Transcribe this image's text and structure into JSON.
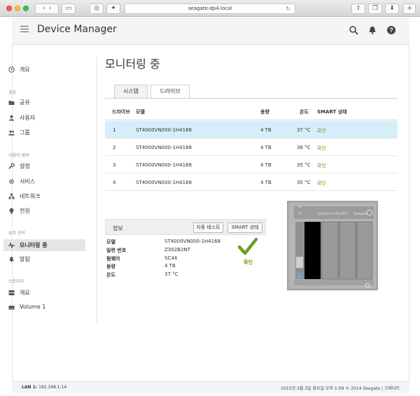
{
  "browser": {
    "url": "seagate-dp4.local"
  },
  "app": {
    "title": "Device Manager"
  },
  "sidebar": {
    "groups": [
      {
        "label": "공유"
      },
      {
        "label": "사용자 정의"
      },
      {
        "label": "유지 관리"
      },
      {
        "label": "스토리지"
      }
    ],
    "items": [
      {
        "label": "개요",
        "icon": "clock-icon"
      },
      {
        "label": "공유",
        "icon": "folder-icon"
      },
      {
        "label": "사용자",
        "icon": "user-icon"
      },
      {
        "label": "그룹",
        "icon": "group-icon"
      },
      {
        "label": "설정",
        "icon": "wrench-icon"
      },
      {
        "label": "서비스",
        "icon": "gear-icon"
      },
      {
        "label": "네트워크",
        "icon": "network-icon"
      },
      {
        "label": "전원",
        "icon": "bulb-icon"
      },
      {
        "label": "모니터링 중",
        "icon": "pulse-icon",
        "active": true
      },
      {
        "label": "알림",
        "icon": "bell-icon"
      },
      {
        "label": "개요",
        "icon": "storage-icon"
      },
      {
        "label": "Volume 1",
        "icon": "volume-icon"
      }
    ]
  },
  "main": {
    "title": "모니터링 중",
    "tabs": [
      {
        "label": "시스템",
        "active": false
      },
      {
        "label": "드라이브",
        "active": true
      }
    ],
    "table": {
      "headers": {
        "drive": "드라이브",
        "model": "모델",
        "capacity": "용량",
        "temp": "온도",
        "smart": "SMART 상태"
      },
      "rows": [
        {
          "drive": "1",
          "model": "ST4000VN000-1H4168",
          "capacity": "4 TB",
          "temp": "37 °C",
          "smart": "확인",
          "selected": true
        },
        {
          "drive": "2",
          "model": "ST4000VN000-1H4168",
          "capacity": "4 TB",
          "temp": "36 °C",
          "smart": "확인"
        },
        {
          "drive": "3",
          "model": "ST4000VN000-1H4168",
          "capacity": "4 TB",
          "temp": "35 °C",
          "smart": "확인"
        },
        {
          "drive": "4",
          "model": "ST4000VN000-1H4168",
          "capacity": "4 TB",
          "temp": "35 °C",
          "smart": "확인"
        }
      ]
    },
    "info": {
      "title": "정보",
      "selftest_label": "자동 테스트",
      "smartstat_label": "SMART 상태",
      "fields": [
        {
          "key": "모델",
          "value": "ST4000VN000-1H4168"
        },
        {
          "key": "일련 번호",
          "value": "Z302B2NT"
        },
        {
          "key": "펌웨어",
          "value": "SC44"
        },
        {
          "key": "용량",
          "value": "4 TB"
        },
        {
          "key": "온도",
          "value": "37 °C"
        }
      ],
      "status": "확인"
    },
    "device_image": {
      "brand": "Seagate",
      "model_label": "SEAGATE-NAS-PRO"
    }
  },
  "footer": {
    "lan_label": "LAN 1:",
    "lan_ip": "192.168.1.14",
    "right": "2015년 2월 3일 화요일  오후 1:09  © 2014 Seagate | 크레디트"
  },
  "colors": {
    "selected_row": "#d6eef9",
    "ok_green": "#6a9e1f"
  }
}
